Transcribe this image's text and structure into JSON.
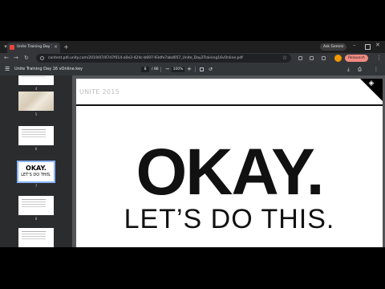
{
  "tabs": [
    {
      "title": "Unite Training Day 16 vOnline.key",
      "close": "×"
    }
  ],
  "tabstrip": {
    "new_tab": "+",
    "gemini": "Ask Gemini"
  },
  "toolbar": {
    "back": "←",
    "forward": "→",
    "reload": "↻",
    "url": "content.pdl.unity.com/2019/07/07d7f014-a0e2-424c-b697-93dfe7abd057_Unite_Day2Training16vOnline.pdf",
    "star": "☆",
    "relaunch": "Relaunch",
    "menu": "⋮"
  },
  "pdf_toolbar": {
    "menu": "☰",
    "title": "Unite Training Day 16 vOnline.key",
    "page_current": "8",
    "page_total": "/ 86",
    "zoom_out": "−",
    "zoom": "100%",
    "zoom_in": "+",
    "more": "⋮"
  },
  "thumbnails": [
    {
      "page": "4"
    },
    {
      "page": "5"
    },
    {
      "page": "6",
      "okay": "OKAY.",
      "lets": "LET'S DO THIS."
    },
    {
      "page": "7"
    },
    {
      "page": "8"
    }
  ],
  "slide": {
    "label": "UNITE 2015",
    "okay": "OKAY.",
    "lets": "LET’S DO THIS.",
    "logo": "◈"
  }
}
